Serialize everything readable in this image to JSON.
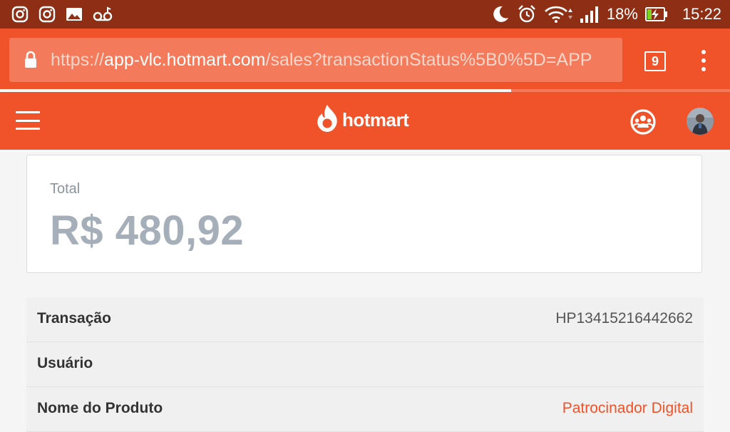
{
  "status_bar": {
    "left_icons": [
      "instagram-icon",
      "instagram-icon",
      "image-icon",
      "voicemail-icon"
    ],
    "right_icons": [
      "moon-icon",
      "alarm-icon",
      "wifi-icon",
      "signal-icon"
    ],
    "battery_percent": "18%",
    "time": "15:22"
  },
  "browser": {
    "url_scheme": "https://",
    "url_host": "app-vlc.hotmart.com",
    "url_path": "/sales?transactionStatus%5B0%5D=APP",
    "tab_count": "9",
    "page_load_progress": 0.7
  },
  "header": {
    "brand": "hotmart"
  },
  "total": {
    "label": "Total",
    "value": "R$ 480,92"
  },
  "details": [
    {
      "label": "Transação",
      "value": "HP13415216442662",
      "link": false
    },
    {
      "label": "Usuário",
      "value": "",
      "link": false
    },
    {
      "label": "Nome do Produto",
      "value": "Patrocinador Digital",
      "link": true
    }
  ],
  "colors": {
    "status_bar": "#8e2f15",
    "brand_orange": "#f0522a",
    "url_box": "#f37a5a",
    "total_text": "#a5afb9"
  }
}
